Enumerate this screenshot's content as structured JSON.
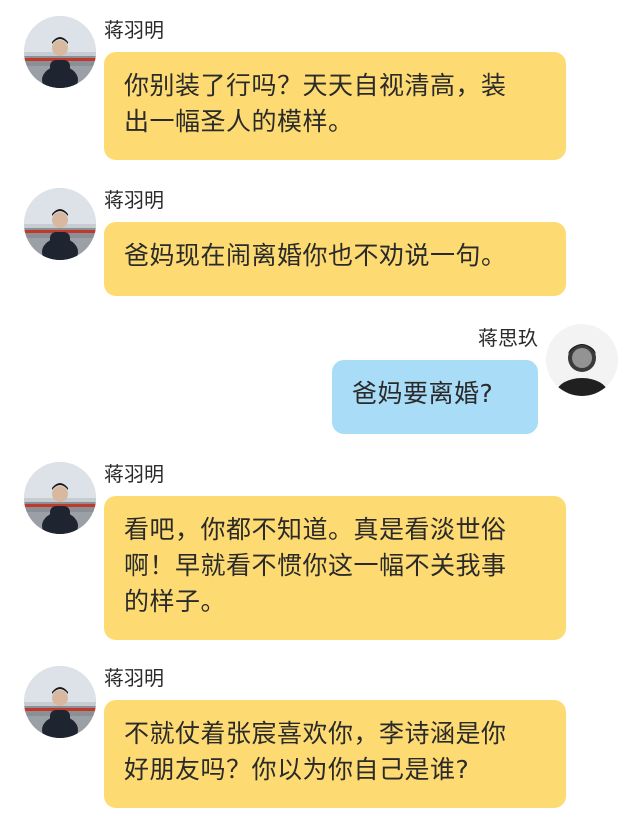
{
  "messages": [
    {
      "sender": "蒋羽明",
      "side": "left",
      "lines": [
        "你别装了行吗？天天自视清高，装",
        "出一幅圣人的模样。"
      ]
    },
    {
      "sender": "蒋羽明",
      "side": "left",
      "lines": [
        "爸妈现在闹离婚你也不劝说一句。"
      ]
    },
    {
      "sender": "蒋思玖",
      "side": "right",
      "lines": [
        "爸妈要离婚?"
      ]
    },
    {
      "sender": "蒋羽明",
      "side": "left",
      "lines": [
        "看吧，你都不知道。真是看淡世俗",
        "啊！早就看不惯你这一幅不关我事",
        "的样子。"
      ]
    },
    {
      "sender": "蒋羽明",
      "side": "left",
      "lines": [
        "不就仗着张宸喜欢你，李诗涵是你",
        "好朋友吗？你以为你自己是谁?"
      ]
    }
  ],
  "colors": {
    "incoming_bubble": "#fddb72",
    "outgoing_bubble": "#a8dcf7"
  },
  "icons": {
    "left_avatar": "avatar-photo-man",
    "right_avatar": "avatar-photo-woman"
  }
}
